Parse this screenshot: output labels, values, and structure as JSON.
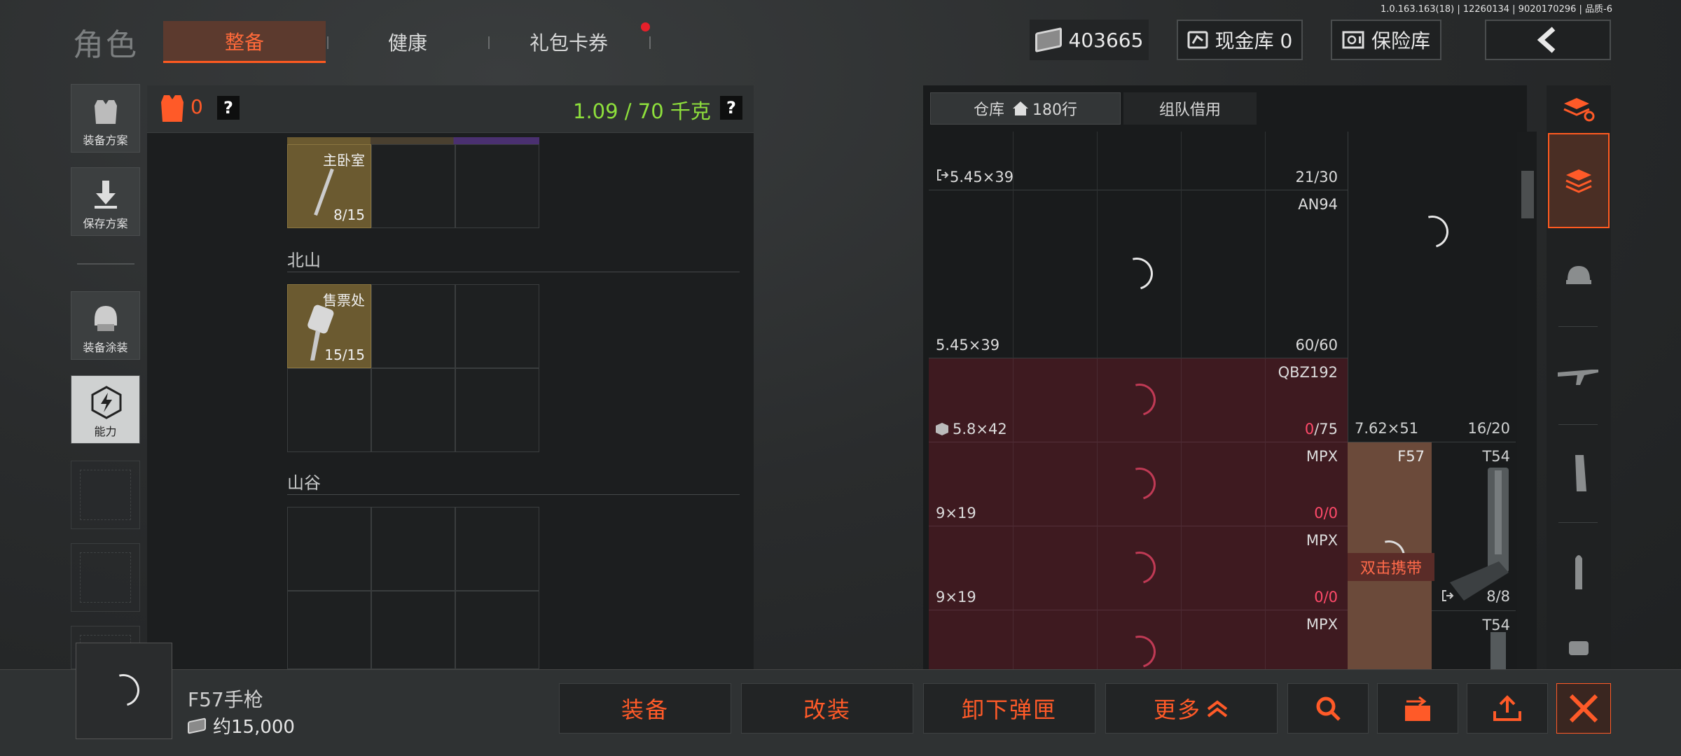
{
  "version_text": "1.0.163.163(18) | 12260134 | 9020170296 | 品质-6",
  "header": {
    "title": "角色",
    "tabs": [
      {
        "label": "整备",
        "active": true
      },
      {
        "label": "健康",
        "active": false
      },
      {
        "label": "礼包卡券",
        "active": false,
        "has_notification": true
      }
    ],
    "currency_value": "403665",
    "cash_vault_label": "现金库 0",
    "safe_label": "保险库"
  },
  "sidebar": {
    "items": [
      {
        "label": "装备方案",
        "icon": "vest-icon"
      },
      {
        "label": "保存方案",
        "icon": "download-icon"
      },
      {
        "label": "装备涂装",
        "icon": "helmet-icon"
      },
      {
        "label": "能力",
        "icon": "lightning-hex-icon"
      }
    ]
  },
  "left_panel": {
    "vest_count": "0",
    "weight_text": "1.09 / 70 千克",
    "help_label": "?",
    "sections": [
      {
        "title": "",
        "item_name": "主卧室",
        "item_count": "8/15"
      },
      {
        "title": "北山",
        "item_name": "售票处",
        "item_count": "15/15"
      },
      {
        "title": "山谷",
        "item_name": "",
        "item_count": ""
      }
    ]
  },
  "warehouse": {
    "tabs": [
      {
        "label": "仓库",
        "sub": "180行",
        "active": true
      },
      {
        "label": "组队借用",
        "active": false
      }
    ],
    "rows": [
      {
        "caliber": "5.45×39",
        "qty": "21/30",
        "name": "",
        "red": false
      },
      {
        "caliber": "5.45×39",
        "qty": "60/60",
        "name": "AN94",
        "red": false
      },
      {
        "caliber": "5.8×42",
        "qty_a": "0",
        "qty_b": "/75",
        "name": "QBZ192",
        "red": true
      },
      {
        "caliber": "9×19",
        "qty_a": "0",
        "qty_b": "/0",
        "name": "MPX",
        "red": true
      },
      {
        "caliber": "9×19",
        "qty_a": "0",
        "qty_b": "/0",
        "name": "MPX",
        "red": true
      },
      {
        "caliber": "",
        "name": "MPX",
        "red": true
      }
    ],
    "side_items": [
      {
        "caliber": "7.62×51",
        "qty": "16/20"
      },
      {
        "name": "F57",
        "action": "双击携带"
      },
      {
        "name": "T54",
        "qty": "8/8"
      },
      {
        "name": "T54"
      }
    ]
  },
  "bottom": {
    "item_name": "F57手枪",
    "item_price": "约15,000",
    "buttons": [
      "装备",
      "改装",
      "卸下弹匣",
      "更多"
    ]
  }
}
